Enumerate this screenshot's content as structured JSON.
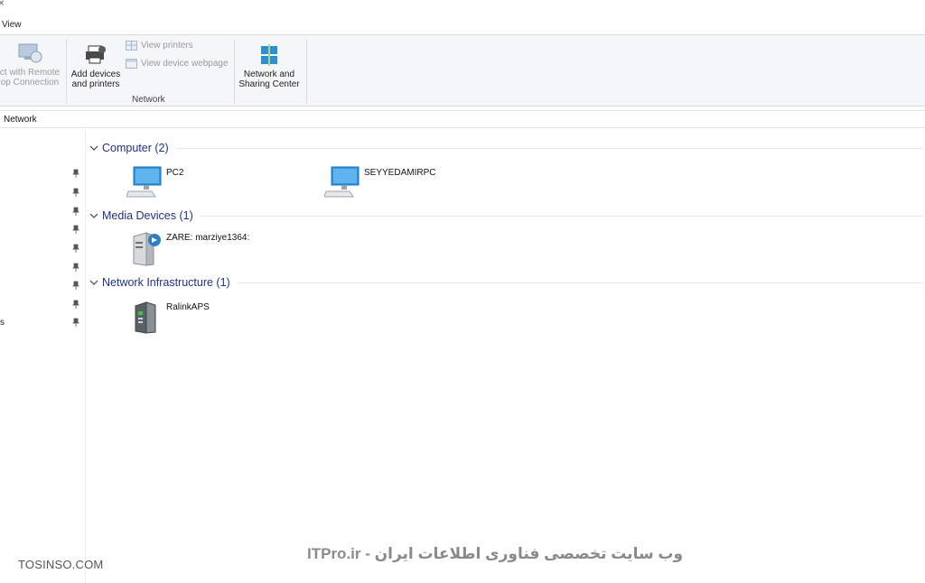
{
  "tabbar": {
    "close_glyph": "×",
    "view_tab": "View"
  },
  "ribbon": {
    "remote_desktop_label": [
      "ct with Remote",
      "op Connection"
    ],
    "add_devices_label": [
      "Add devices",
      "and printers"
    ],
    "view_printers_label": "View printers",
    "view_device_webpage_label": "View device webpage",
    "network_group_label": "Network",
    "network_sharing_label": [
      "Network and",
      "Sharing Center"
    ]
  },
  "address": {
    "path": "Network"
  },
  "navpane": {
    "fragment": "s"
  },
  "groups": {
    "computer": {
      "title": "Computer (2)",
      "items": [
        "PC2",
        "SEYYEDAMIRPC"
      ]
    },
    "media": {
      "title": "Media Devices (1)",
      "items": [
        "ZARE: marziye1364:"
      ]
    },
    "infra": {
      "title": "Network Infrastructure (1)",
      "items": [
        "RalinkAPS"
      ]
    }
  },
  "watermarks": {
    "left": "TOSINSO.COM",
    "center": "ITPro.ir - وب سایت تخصصی فناوری اطلاعات ایران"
  },
  "colors": {
    "group_title": "#1e3287",
    "ribbon_bg": "#f5f6f7"
  }
}
